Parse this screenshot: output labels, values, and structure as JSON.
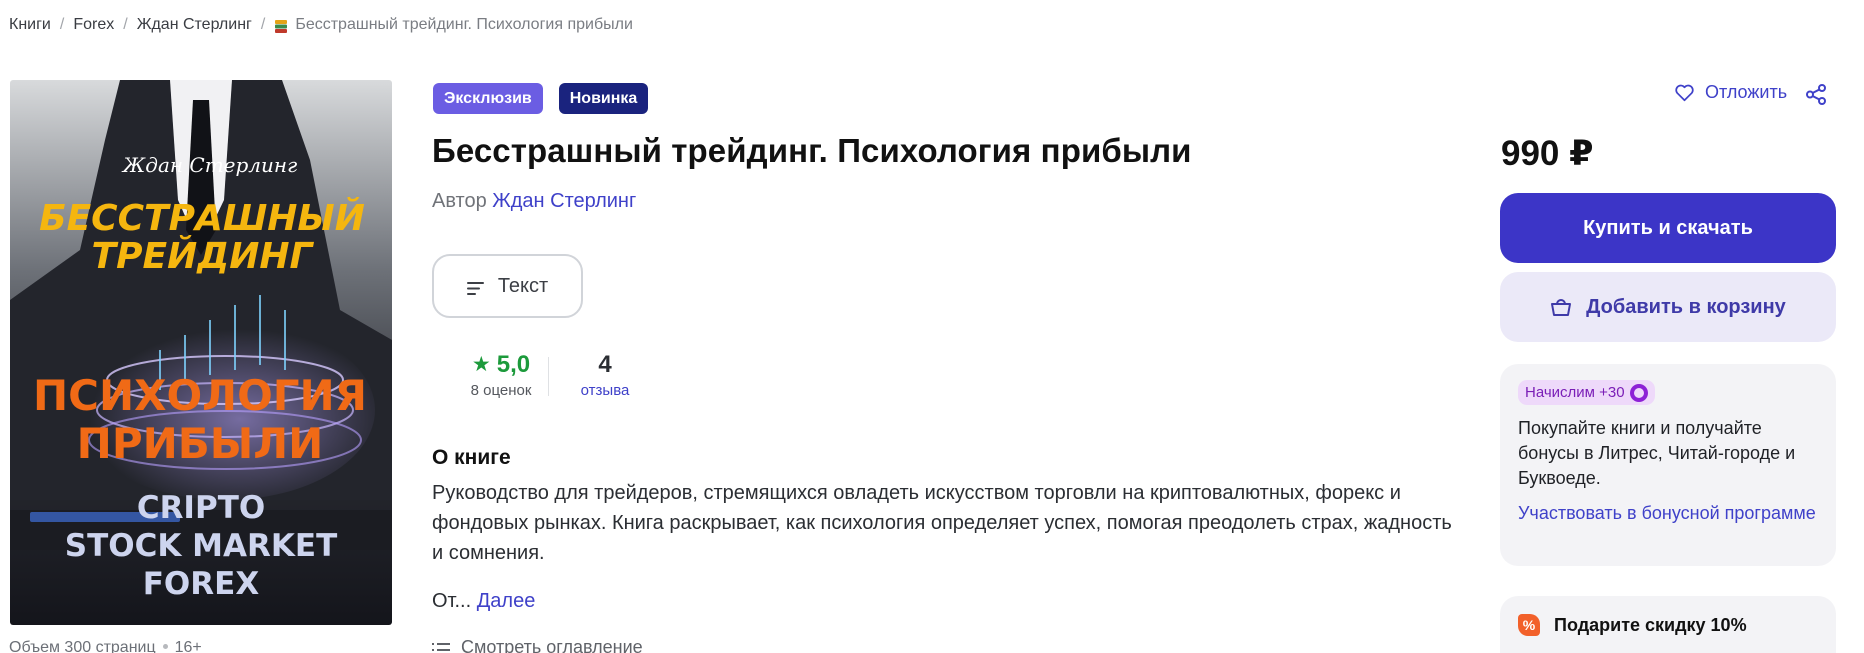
{
  "breadcrumb": {
    "items": [
      "Книги",
      "Forex",
      "Ждан Стерлинг"
    ],
    "current": "Бесстрашный трейдинг. Психология прибыли",
    "separator": "/"
  },
  "cover": {
    "author_text": "Ждан Стерлинг",
    "title_line1": "БЕССТРАШНЫЙ",
    "title_line2": "ТРЕЙДИНГ",
    "subtitle_line1": "ПСИХОЛОГИЯ",
    "subtitle_line2": "ПРИБЫЛИ",
    "footer_line1": "CRIPTO",
    "footer_line2": "STOCK MARKET",
    "footer_line3": "FOREX",
    "colors": {
      "title": "#f5b60f",
      "subtitle": "#f06a16",
      "footer": "#cdd4ee"
    }
  },
  "meta": {
    "pages": "Объем 300 страниц",
    "age": "16+"
  },
  "badges": {
    "exclusive": "Эксклюзив",
    "new": "Новинка"
  },
  "book": {
    "title": "Бесстрашный трейдинг. Психология прибыли",
    "author_prefix": "Автор",
    "author_name": "Ждан Стерлинг",
    "format": "Текст"
  },
  "rating": {
    "score": "5,0",
    "count_label": "8 оценок",
    "reviews_num": "4",
    "reviews_label": "отзыва"
  },
  "about": {
    "title": "О книге",
    "text": "Руководство для трейдеров, стремящихся овладеть искусством торговли на криптовалютных, форекс и фондовых рынках. Книга раскрывает, как психология определяет успех, помогая преодолеть страх, жадность и сомнения.",
    "more_prefix": "От...",
    "more_link": "Далее",
    "toc": "Смотреть оглавление"
  },
  "actions": {
    "save": "Отложить",
    "price": "990 ₽",
    "buy": "Купить и скачать",
    "cart": "Добавить в корзину"
  },
  "bonus": {
    "pill": "Начислим +30",
    "text": "Покупайте книги и получайте бонусы в Литрес, Читай-городе и Буквоеде.",
    "link": "Участвовать в бонусной программе"
  },
  "discount": {
    "title": "Подарите скидку 10%",
    "icon_text": "%"
  },
  "colors": {
    "accent": "#3c35c7",
    "link": "#3f41c9",
    "rating_green": "#1c9a3b",
    "badge_exclusive": "#6b5de3",
    "badge_new": "#1a237e",
    "bonus_purple": "#7b1fb7",
    "discount_orange": "#f2602a"
  }
}
